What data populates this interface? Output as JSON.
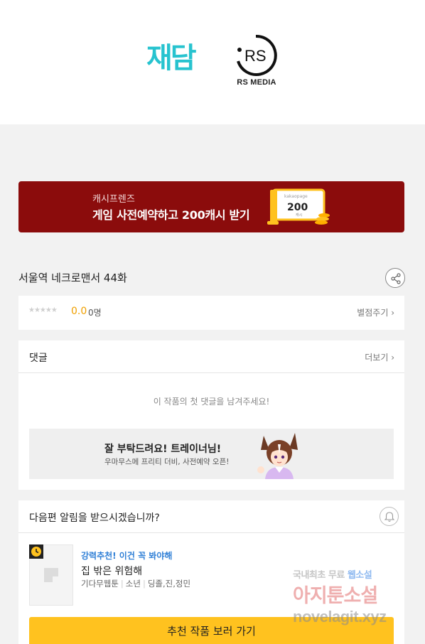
{
  "header": {
    "partner_logo_text": "재담",
    "publisher_logo_text": "RS MEDIA",
    "publisher_logo_mark": "RS"
  },
  "banner": {
    "subtitle": "캐시프렌즈",
    "title": "게임 사전예약하고 200캐시 받기",
    "art_value": "200",
    "art_caption_top": "kakaopage",
    "art_caption_bottom": "캐시"
  },
  "episode": {
    "title": "서울역 네크로맨서 44화",
    "share_icon": "share-icon"
  },
  "rating": {
    "stars": "★★★★★",
    "score": "0.0",
    "count": "0명",
    "rate_link": "별점주기 ›"
  },
  "comments": {
    "title": "댓글",
    "more": "더보기 ›",
    "empty_message": "이 작품의 첫 댓글을 남겨주세요!",
    "promo": {
      "title": "잘 부탁드려요! 트레이너님!",
      "subtitle": "우마무스메 프리티 더비, 사전예약 오픈!"
    }
  },
  "notify": {
    "title": "다음편 알림을 받으시겠습니까?",
    "bell_icon": "bell-icon"
  },
  "recommend": {
    "label": "강력추천! 이건 꼭 봐야해",
    "title": "집 밖은 위험해",
    "meta": [
      "기다무웹툰",
      "소년",
      "딩졸,진,정민"
    ],
    "cta": "추천 작품 보러 가기"
  },
  "watermark": {
    "top_gray": "국내최초 무료",
    "top_blue": "웹소설",
    "middle": "아지툰소설",
    "bottom": "novelagit.xyz"
  },
  "colors": {
    "jaedam_teal": "#27c3cf",
    "banner_red": "#8b0c0c",
    "score_orange": "#f0a000",
    "recommend_blue": "#2f7fd6",
    "cta_yellow": "#ffc21f"
  }
}
